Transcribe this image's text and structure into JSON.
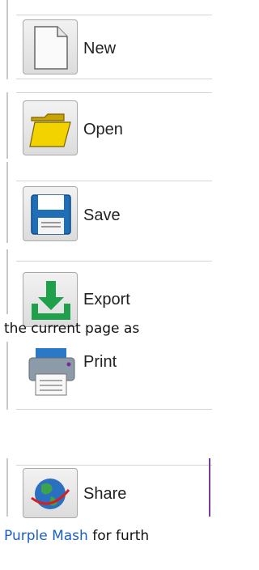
{
  "menu": {
    "new_label": "New",
    "open_label": "Open",
    "save_label": "Save",
    "export_label": "Export",
    "print_label": "Print",
    "share_label": "Share"
  },
  "text": {
    "fragment_1": "the current page as",
    "link": "Purple Mash",
    "fragment_2": " for furth"
  },
  "icons": [
    "new-document-icon",
    "folder-icon",
    "floppy-disk-icon",
    "download-icon",
    "printer-icon",
    "globe-icon"
  ],
  "colors": {
    "link": "#1a5fc8",
    "accent": "#7a3c9a"
  }
}
